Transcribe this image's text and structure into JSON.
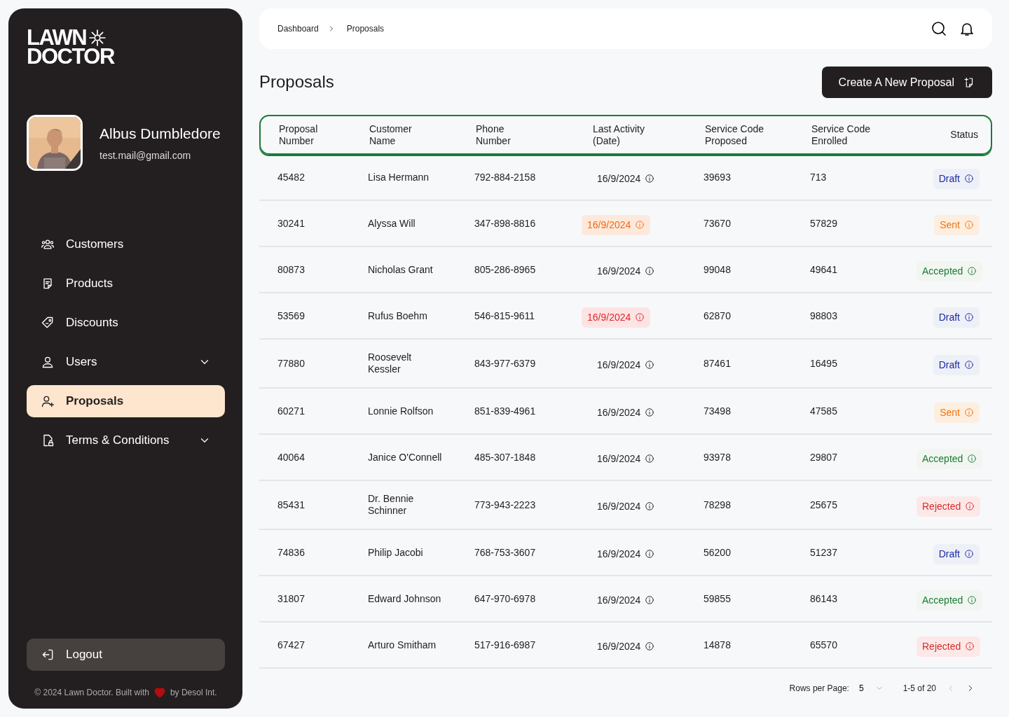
{
  "sidebar": {
    "logo": {
      "line1": "LAWN",
      "line2": "DOCTOR"
    },
    "profile": {
      "name": "Albus Dumbledore",
      "email": "test.mail@gmail.com"
    },
    "items": [
      {
        "label": "Customers",
        "selected": false,
        "expandable": false
      },
      {
        "label": "Products",
        "selected": false,
        "expandable": false
      },
      {
        "label": "Discounts",
        "selected": false,
        "expandable": false
      },
      {
        "label": "Users",
        "selected": false,
        "expandable": true
      },
      {
        "label": "Proposals",
        "selected": true,
        "expandable": false
      },
      {
        "label": "Terms & Conditions",
        "selected": false,
        "expandable": true
      }
    ],
    "logout": "Logout",
    "footer": {
      "before": "© 2024 Lawn Doctor. Built with",
      "after": "by Desol Int."
    }
  },
  "breadcrumb": [
    "Dashboard",
    "Proposals"
  ],
  "page_title": "Proposals",
  "create_button": "Create A New Proposal",
  "table": {
    "columns": [
      [
        "Proposal",
        "Number"
      ],
      [
        "Customer",
        "Name"
      ],
      [
        "Phone",
        "Number"
      ],
      [
        "Last Activity",
        "(Date)"
      ],
      [
        "Service Code",
        "Proposed"
      ],
      [
        "Service Code",
        "Enrolled"
      ],
      [
        "Status"
      ]
    ],
    "rows": [
      {
        "number": "45482",
        "customer": "Lisa Hermann",
        "phone": "792-884-2158",
        "date": {
          "text": "16/9/2024",
          "kind": "normal"
        },
        "proposed": "39693",
        "enrolled": "713",
        "status": {
          "text": "Draft",
          "kind": "draft"
        }
      },
      {
        "number": "30241",
        "customer": "Alyssa Will",
        "phone": "347-898-8816",
        "date": {
          "text": "16/9/2024",
          "kind": "warning"
        },
        "proposed": "73670",
        "enrolled": "57829",
        "status": {
          "text": "Sent",
          "kind": "sent"
        }
      },
      {
        "number": "80873",
        "customer": "Nicholas Grant",
        "phone": "805-286-8965",
        "date": {
          "text": "16/9/2024",
          "kind": "normal"
        },
        "proposed": "99048",
        "enrolled": "49641",
        "status": {
          "text": "Accepted",
          "kind": "accepted"
        }
      },
      {
        "number": "53569",
        "customer": "Rufus Boehm",
        "phone": "546-815-9611",
        "date": {
          "text": "16/9/2024",
          "kind": "overdue"
        },
        "proposed": "62870",
        "enrolled": "98803",
        "status": {
          "text": "Draft",
          "kind": "draft"
        }
      },
      {
        "number": "77880",
        "customer": "Roosevelt Kessler",
        "phone": "843-977-6379",
        "date": {
          "text": "16/9/2024",
          "kind": "normal"
        },
        "proposed": "87461",
        "enrolled": "16495",
        "status": {
          "text": "Draft",
          "kind": "draft"
        }
      },
      {
        "number": "60271",
        "customer": "Lonnie Rolfson",
        "phone": "851-839-4961",
        "date": {
          "text": "16/9/2024",
          "kind": "normal"
        },
        "proposed": "73498",
        "enrolled": "47585",
        "status": {
          "text": "Sent",
          "kind": "sent"
        }
      },
      {
        "number": "40064",
        "customer": "Janice O'Connell",
        "phone": "485-307-1848",
        "date": {
          "text": "16/9/2024",
          "kind": "normal"
        },
        "proposed": "93978",
        "enrolled": "29807",
        "status": {
          "text": "Accepted",
          "kind": "accepted"
        }
      },
      {
        "number": "85431",
        "customer": "Dr. Bennie Schinner",
        "phone": "773-943-2223",
        "date": {
          "text": "16/9/2024",
          "kind": "normal"
        },
        "proposed": "78298",
        "enrolled": "25675",
        "status": {
          "text": "Rejected",
          "kind": "rejected"
        }
      },
      {
        "number": "74836",
        "customer": "Philip Jacobi",
        "phone": "768-753-3607",
        "date": {
          "text": "16/9/2024",
          "kind": "normal"
        },
        "proposed": "56200",
        "enrolled": "51237",
        "status": {
          "text": "Draft",
          "kind": "draft"
        }
      },
      {
        "number": "31807",
        "customer": "Edward Johnson",
        "phone": "647-970-6978",
        "date": {
          "text": "16/9/2024",
          "kind": "normal"
        },
        "proposed": "59855",
        "enrolled": "86143",
        "status": {
          "text": "Accepted",
          "kind": "accepted"
        }
      },
      {
        "number": "67427",
        "customer": "Arturo Smitham",
        "phone": "517-916-6987",
        "date": {
          "text": "16/9/2024",
          "kind": "normal"
        },
        "proposed": "14878",
        "enrolled": "65570",
        "status": {
          "text": "Rejected",
          "kind": "rejected"
        }
      }
    ]
  },
  "pagination": {
    "rows_label": "Rows per Page:",
    "rows_value": "5",
    "range": "1-5 of 20",
    "prev_disabled": true,
    "next_disabled": false
  }
}
